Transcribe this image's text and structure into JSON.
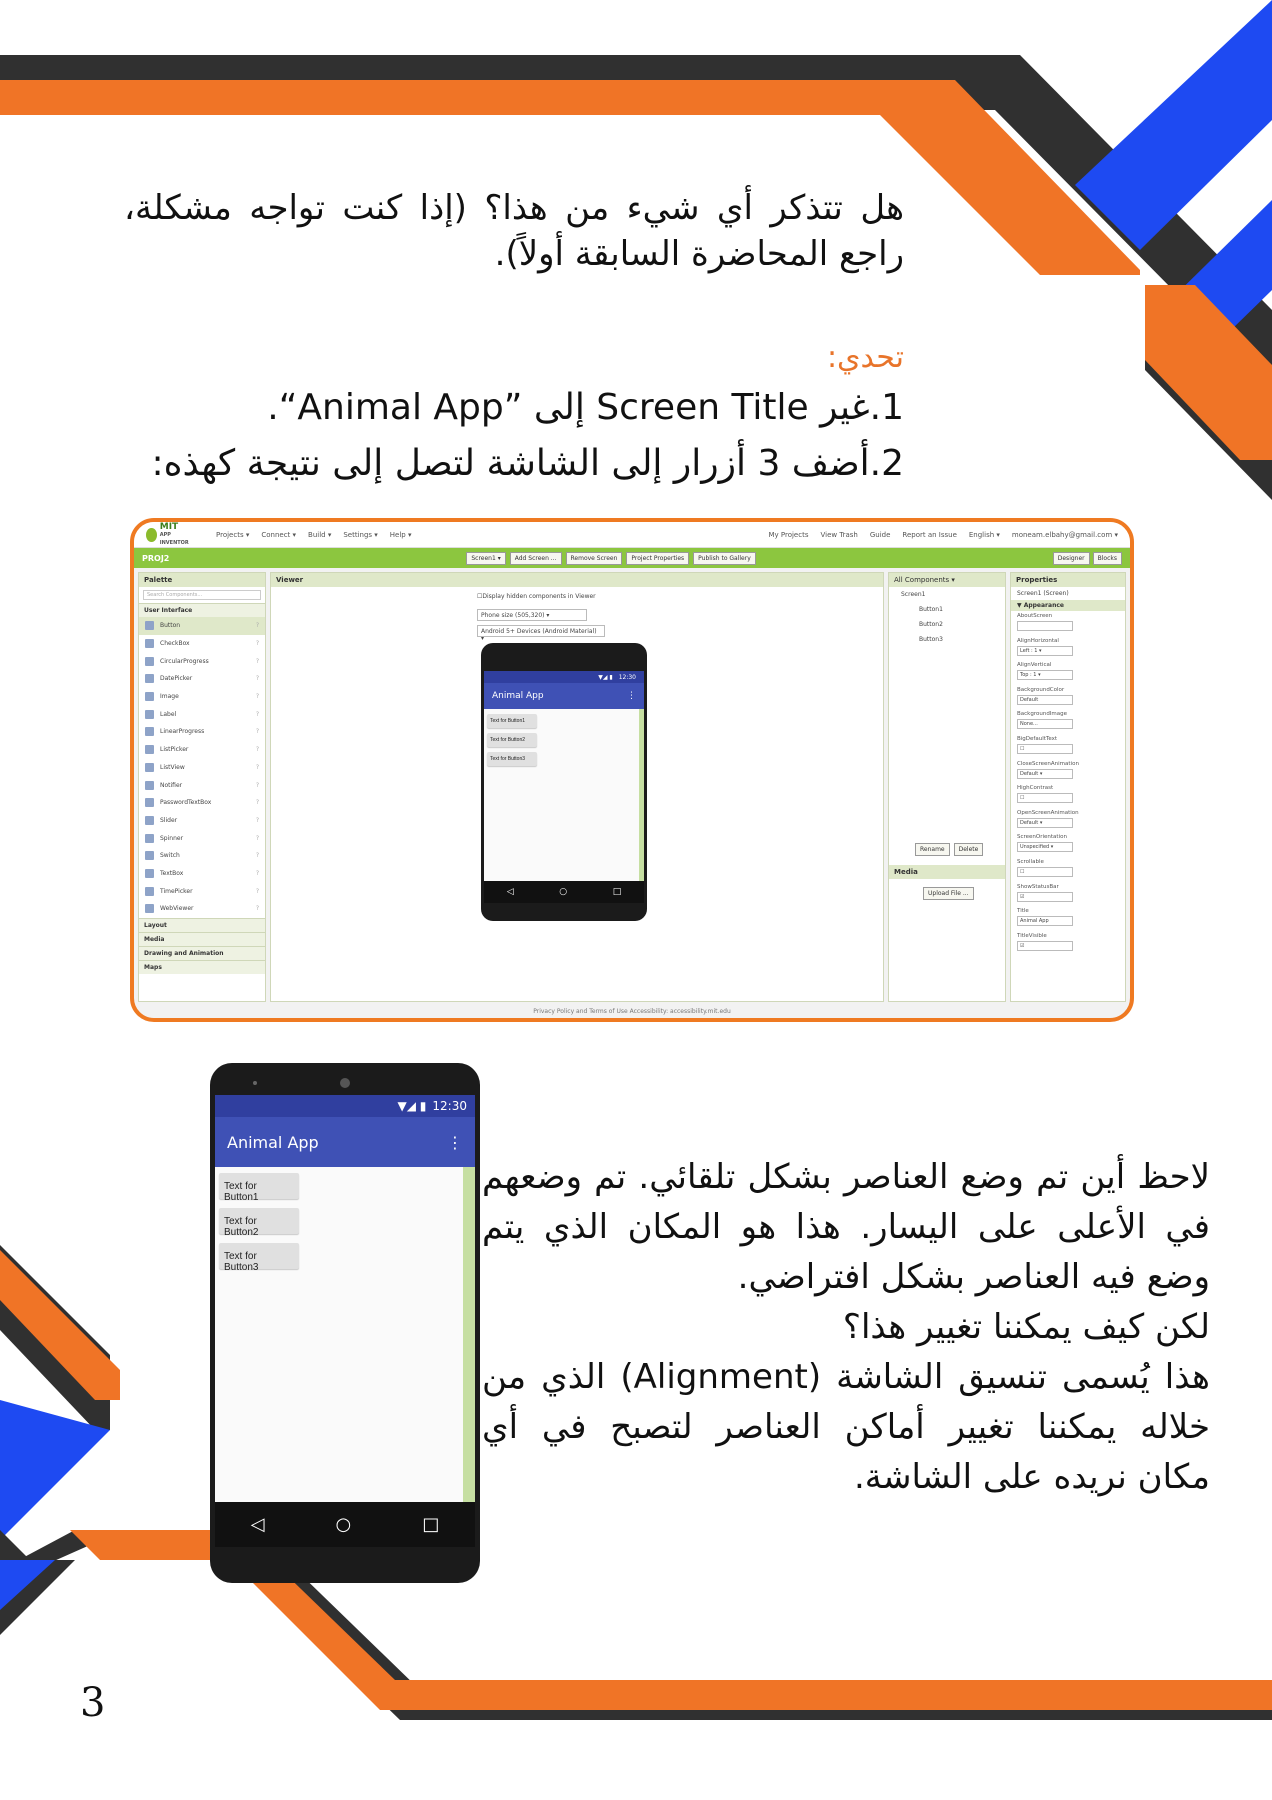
{
  "colors": {
    "orange": "#f07426",
    "blue": "#1e4af2",
    "dark": "#303030"
  },
  "intro": "هل تتذكر أي شيء من هذا؟ (إذا كنت تواجه مشكلة، راجع المحاضرة السابقة أولاً).",
  "challenge": {
    "title": "تحدي:",
    "step1_num": "1.",
    "step1_text": "غير Screen Title إلى ”Animal App“.",
    "step2_num": "2.",
    "step2_text": "أضف 3 أزرار إلى الشاشة لتصل إلى نتيجة كهذه:"
  },
  "app_inventor": {
    "logo_top": "MIT",
    "logo_bottom": "APP INVENTOR",
    "menu": [
      "Projects ▾",
      "Connect ▾",
      "Build ▾",
      "Settings ▾",
      "Help ▾"
    ],
    "right_menu": [
      "My Projects",
      "View Trash",
      "Guide",
      "Report an Issue",
      "English ▾",
      "moneam.elbahy@gmail.com ▾"
    ],
    "project": "PROJ2",
    "toolbar": [
      "Screen1 ▾",
      "Add Screen ...",
      "Remove Screen",
      "Project Properties",
      "Publish to Gallery"
    ],
    "mode_buttons": [
      "Designer",
      "Blocks"
    ],
    "palette_title": "Palette",
    "search_placeholder": "Search Components...",
    "ui_category": "User Interface",
    "palette_items": [
      "Button",
      "CheckBox",
      "CircularProgress",
      "DatePicker",
      "Image",
      "Label",
      "LinearProgress",
      "ListPicker",
      "ListView",
      "Notifier",
      "PasswordTextBox",
      "Slider",
      "Spinner",
      "Switch",
      "TextBox",
      "TimePicker",
      "WebViewer"
    ],
    "other_categories": [
      "Layout",
      "Media",
      "Drawing and Animation",
      "Maps"
    ],
    "viewer_title": "Viewer",
    "hidden_toggle": "Display hidden components in Viewer",
    "phone_size": "Phone size (505,320) ▾",
    "theme": "Android 5+ Devices (Android Material) ▾",
    "components_title": "All Components ▾",
    "tree": [
      "Screen1",
      "Button1",
      "Button2",
      "Button3"
    ],
    "rename": "Rename",
    "delete": "Delete",
    "media_title": "Media",
    "upload": "Upload File ...",
    "properties_title": "Properties",
    "props_screen": "Screen1 (Screen)",
    "props_group": "▼ Appearance",
    "props": [
      {
        "label": "AboutScreen",
        "value": ""
      },
      {
        "label": "AlignHorizontal",
        "value": "Left : 1 ▾"
      },
      {
        "label": "AlignVertical",
        "value": "Top : 1 ▾"
      },
      {
        "label": "BackgroundColor",
        "value": "Default"
      },
      {
        "label": "BackgroundImage",
        "value": "None..."
      },
      {
        "label": "BigDefaultText",
        "value": "☐"
      },
      {
        "label": "CloseScreenAnimation",
        "value": "Default ▾"
      },
      {
        "label": "HighContrast",
        "value": "☐"
      },
      {
        "label": "OpenScreenAnimation",
        "value": "Default ▾"
      },
      {
        "label": "ScreenOrientation",
        "value": "Unspecified ▾"
      },
      {
        "label": "Scrollable",
        "value": "☐"
      },
      {
        "label": "ShowStatusBar",
        "value": "☑"
      },
      {
        "label": "Title",
        "value": "Animal App"
      },
      {
        "label": "TitleVisible",
        "value": "☑"
      }
    ],
    "footer": "Privacy Policy and Terms of Use    Accessibility: accessibility.mit.edu"
  },
  "phone": {
    "time": "12:30",
    "status_icons": "▼◢ ▮",
    "app_title": "Animal App",
    "menu_icon": "⋮",
    "buttons": [
      "Text for Button1",
      "Text for Button2",
      "Text for Button3"
    ],
    "nav": [
      "◁",
      "○",
      "□"
    ]
  },
  "observation": [
    "لاحظ أين تم وضع العناصر بشكل تلقائي. تم وضعهم",
    "في الأعلى على اليسار. هذا هو المكان الذي يتم",
    "وضع فيه العناصر بشكل افتراضي.",
    "لكن كيف يمكننا تغيير هذا؟",
    "هذا يُسمى تنسيق الشاشة (Alignment) الذي من",
    "خلاله يمكننا تغيير أماكن العناصر لتصبح في أي",
    "مكان نريده على الشاشة."
  ],
  "page_number": "3"
}
